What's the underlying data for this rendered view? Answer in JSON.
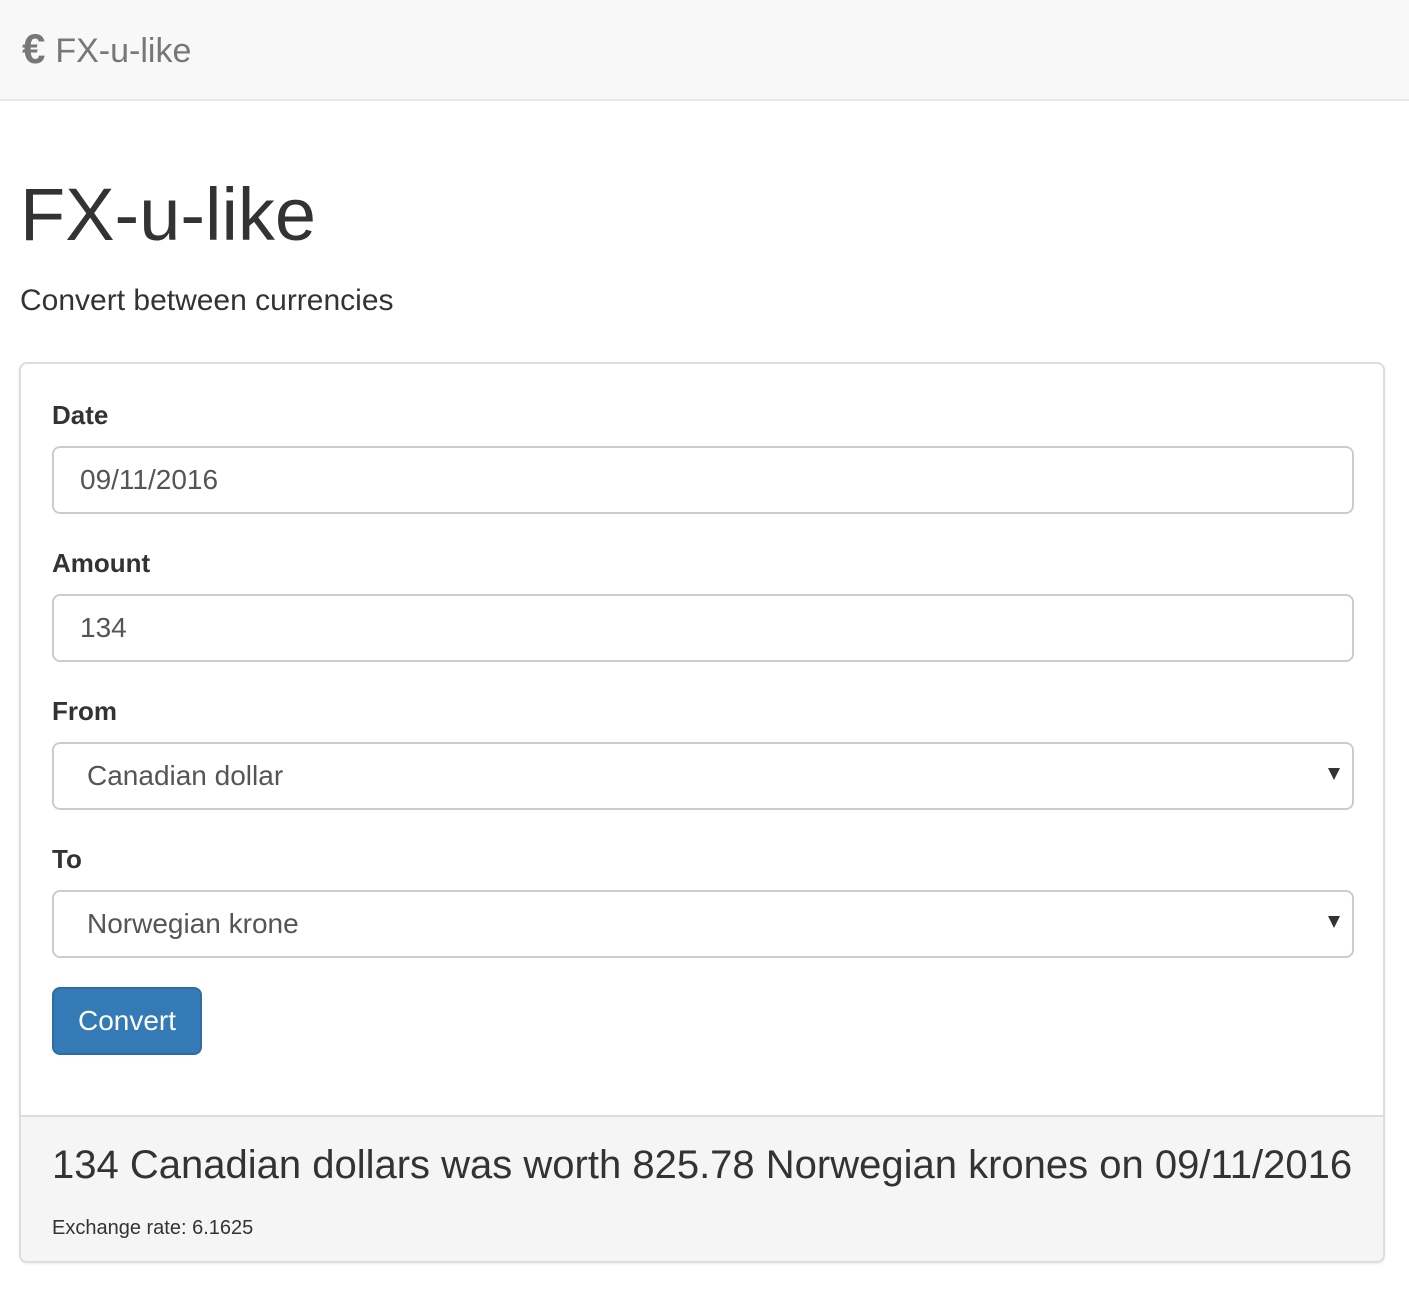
{
  "navbar": {
    "brand_icon": "€",
    "brand_text": "FX-u-like"
  },
  "header": {
    "title": "FX-u-like",
    "subtitle": "Convert between currencies"
  },
  "form": {
    "date": {
      "label": "Date",
      "value": "09/11/2016"
    },
    "amount": {
      "label": "Amount",
      "value": "134"
    },
    "from": {
      "label": "From",
      "selected": "Canadian dollar"
    },
    "to": {
      "label": "To",
      "selected": "Norwegian krone"
    },
    "convert_label": "Convert"
  },
  "result": {
    "summary": "134 Canadian dollars was worth 825.78 Norwegian krones on 09/11/2016",
    "rate": "Exchange rate: 6.1625"
  },
  "colors": {
    "primary": "#337ab7",
    "navbar_bg": "#f8f8f8",
    "footer_bg": "#f5f5f5"
  }
}
